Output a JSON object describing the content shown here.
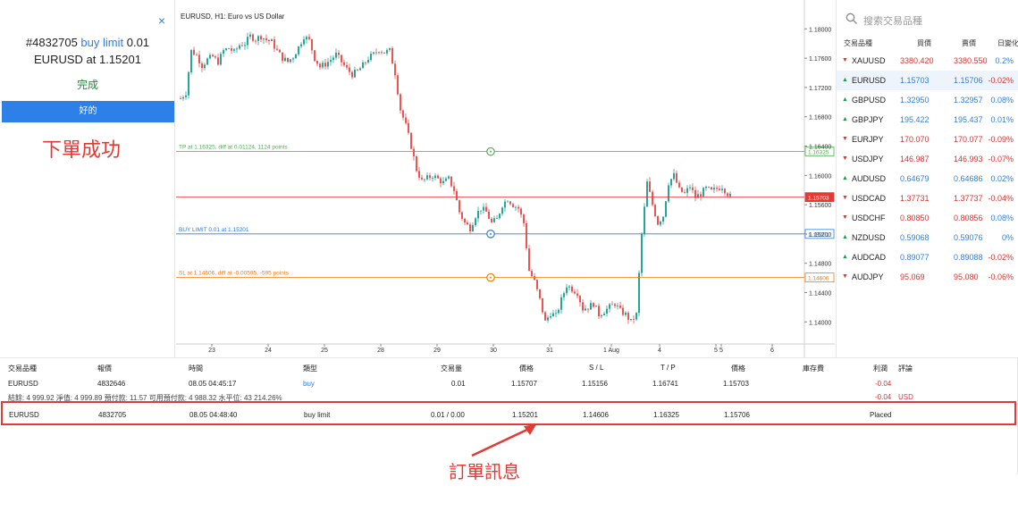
{
  "order_panel": {
    "close_icon": "×",
    "order_ticket": "#4832705",
    "order_type": "buy limit",
    "order_volume": "0.01",
    "order_line2": "EURUSD at 1.15201",
    "status": "完成",
    "ok_label": "好的"
  },
  "annotations": {
    "success": "下單成功",
    "order_info": "訂單訊息"
  },
  "chart": {
    "title": "EURUSD, H1: Euro vs US Dollar",
    "current_price": "1.15703",
    "lines": {
      "tp_label": "TP at 1.16325, diff at 0.01124, 1124 points",
      "tp_tag": "1.16325",
      "buy_label": "BUY LIMIT 0.01 at 1.15201",
      "buy_tag": "1.15201",
      "sl_label": "SL at 1.14606, diff at -0.00595, -595 points",
      "sl_tag": "1.14606"
    },
    "colors": {
      "up": "#26a69a",
      "down": "#ef5350",
      "tp": "#4caf50",
      "buy": "#2d7fe0",
      "sl": "#f57c00",
      "bid": "#e53935"
    }
  },
  "chart_data": {
    "type": "candlestick",
    "title": "EURUSD, H1: Euro vs US Dollar",
    "y_ticks": [
      "1.18000",
      "1.17600",
      "1.17200",
      "1.16800",
      "1.16400",
      "1.16000",
      "1.15600",
      "1.15200",
      "1.14800",
      "1.14400",
      "1.14000"
    ],
    "x_ticks": [
      "23",
      "24",
      "25",
      "28",
      "29",
      "30",
      "31",
      "1 Aug",
      "4",
      "5",
      "5",
      "6"
    ],
    "ylim": [
      1.1376,
      1.1815
    ],
    "levels": {
      "tp": 1.16325,
      "buy_limit": 1.15201,
      "sl": 1.14606,
      "bid": 1.15703
    },
    "close_path": [
      [
        0,
        1.1705
      ],
      [
        6,
        1.1713
      ],
      [
        12,
        1.177
      ],
      [
        18,
        1.1764
      ],
      [
        24,
        1.175
      ],
      [
        30,
        1.1758
      ],
      [
        36,
        1.1762
      ],
      [
        42,
        1.1755
      ],
      [
        48,
        1.177
      ],
      [
        54,
        1.1774
      ],
      [
        60,
        1.1768
      ],
      [
        66,
        1.1778
      ],
      [
        72,
        1.178
      ],
      [
        78,
        1.179
      ],
      [
        84,
        1.1786
      ],
      [
        90,
        1.179
      ],
      [
        96,
        1.1785
      ],
      [
        102,
        1.1782
      ],
      [
        108,
        1.177
      ],
      [
        114,
        1.176
      ],
      [
        120,
        1.1755
      ],
      [
        126,
        1.1762
      ],
      [
        132,
        1.1775
      ],
      [
        138,
        1.179
      ],
      [
        144,
        1.1784
      ],
      [
        150,
        1.176
      ],
      [
        156,
        1.1748
      ],
      [
        162,
        1.1752
      ],
      [
        168,
        1.1758
      ],
      [
        174,
        1.1765
      ],
      [
        180,
        1.1755
      ],
      [
        186,
        1.1745
      ],
      [
        192,
        1.1738
      ],
      [
        198,
        1.1742
      ],
      [
        204,
        1.175
      ],
      [
        210,
        1.176
      ],
      [
        216,
        1.1765
      ],
      [
        222,
        1.1772
      ],
      [
        228,
        1.1768
      ],
      [
        234,
        1.177
      ],
      [
        240,
        1.174
      ],
      [
        246,
        1.169
      ],
      [
        252,
        1.1668
      ],
      [
        258,
        1.164
      ],
      [
        264,
        1.1608
      ],
      [
        270,
        1.1592
      ],
      [
        276,
        1.1596
      ],
      [
        282,
        1.16
      ],
      [
        288,
        1.1595
      ],
      [
        294,
        1.159
      ],
      [
        300,
        1.1595
      ],
      [
        306,
        1.158
      ],
      [
        312,
        1.155
      ],
      [
        318,
        1.1535
      ],
      [
        324,
        1.1528
      ],
      [
        330,
        1.1545
      ],
      [
        336,
        1.1555
      ],
      [
        342,
        1.155
      ],
      [
        348,
        1.1535
      ],
      [
        354,
        1.154
      ],
      [
        360,
        1.156
      ],
      [
        366,
        1.1568
      ],
      [
        372,
        1.156
      ],
      [
        378,
        1.1555
      ],
      [
        384,
        1.1535
      ],
      [
        390,
        1.147
      ],
      [
        396,
        1.1455
      ],
      [
        402,
        1.143
      ],
      [
        408,
        1.14
      ],
      [
        414,
        1.1412
      ],
      [
        420,
        1.1408
      ],
      [
        426,
        1.143
      ],
      [
        432,
        1.145
      ],
      [
        438,
        1.1445
      ],
      [
        444,
        1.144
      ],
      [
        450,
        1.1418
      ],
      [
        456,
        1.142
      ],
      [
        462,
        1.1425
      ],
      [
        468,
        1.141
      ],
      [
        474,
        1.1415
      ],
      [
        480,
        1.142
      ],
      [
        486,
        1.1425
      ],
      [
        492,
        1.1415
      ],
      [
        498,
        1.141
      ],
      [
        504,
        1.14
      ],
      [
        510,
        1.141
      ],
      [
        516,
        1.152
      ],
      [
        522,
        1.159
      ],
      [
        528,
        1.156
      ],
      [
        534,
        1.1535
      ],
      [
        540,
        1.1545
      ],
      [
        546,
        1.159
      ],
      [
        552,
        1.16
      ],
      [
        558,
        1.158
      ],
      [
        564,
        1.1575
      ],
      [
        570,
        1.1585
      ],
      [
        576,
        1.157
      ],
      [
        582,
        1.1575
      ],
      [
        588,
        1.1582
      ],
      [
        594,
        1.1578
      ],
      [
        600,
        1.1582
      ],
      [
        606,
        1.1585
      ],
      [
        612,
        1.1575
      ],
      [
        616,
        1.157
      ]
    ]
  },
  "watchlist": {
    "search_placeholder": "搜索交易品種",
    "headers": [
      "交易品種",
      "買價",
      "賣價",
      "日變化"
    ],
    "rows": [
      {
        "symbol": "XAUUSD",
        "dir": "down",
        "bid": "3380.420",
        "ask": "3380.550",
        "change": "0.2%",
        "color": "red",
        "change_color": "blue"
      },
      {
        "symbol": "EURUSD",
        "dir": "up",
        "bid": "1.15703",
        "ask": "1.15706",
        "change": "-0.02%",
        "color": "blue",
        "change_color": "red",
        "selected": true
      },
      {
        "symbol": "GBPUSD",
        "dir": "up",
        "bid": "1.32950",
        "ask": "1.32957",
        "change": "0.08%",
        "color": "blue",
        "change_color": "blue"
      },
      {
        "symbol": "GBPJPY",
        "dir": "up",
        "bid": "195.422",
        "ask": "195.437",
        "change": "0.01%",
        "color": "blue",
        "change_color": "blue"
      },
      {
        "symbol": "EURJPY",
        "dir": "down",
        "bid": "170.070",
        "ask": "170.077",
        "change": "-0.09%",
        "color": "red",
        "change_color": "red"
      },
      {
        "symbol": "USDJPY",
        "dir": "down",
        "bid": "146.987",
        "ask": "146.993",
        "change": "-0.07%",
        "color": "red",
        "change_color": "red"
      },
      {
        "symbol": "AUDUSD",
        "dir": "up",
        "bid": "0.64679",
        "ask": "0.64686",
        "change": "0.02%",
        "color": "blue",
        "change_color": "blue"
      },
      {
        "symbol": "USDCAD",
        "dir": "down",
        "bid": "1.37731",
        "ask": "1.37737",
        "change": "-0.04%",
        "color": "red",
        "change_color": "red"
      },
      {
        "symbol": "USDCHF",
        "dir": "down",
        "bid": "0.80850",
        "ask": "0.80856",
        "change": "0.08%",
        "color": "red",
        "change_color": "blue"
      },
      {
        "symbol": "NZDUSD",
        "dir": "up",
        "bid": "0.59068",
        "ask": "0.59076",
        "change": "0%",
        "color": "blue",
        "change_color": "blue"
      },
      {
        "symbol": "AUDCAD",
        "dir": "up",
        "bid": "0.89077",
        "ask": "0.89088",
        "change": "-0.02%",
        "color": "blue",
        "change_color": "red"
      },
      {
        "symbol": "AUDJPY",
        "dir": "down",
        "bid": "95.069",
        "ask": "95.080",
        "change": "-0.06%",
        "color": "red",
        "change_color": "red"
      }
    ]
  },
  "table": {
    "headers": {
      "symbol": "交易品種",
      "ticket": "報價",
      "time": "時間",
      "type": "類型",
      "volume": "交易量",
      "price": "價格",
      "sl": "S / L",
      "tp": "T / P",
      "cur_price": "價格",
      "swap": "庫存費",
      "profit": "利潤",
      "comment": "評論"
    },
    "position": {
      "symbol": "EURUSD",
      "ticket": "4832646",
      "time": "08.05 04:45:17",
      "type": "buy",
      "volume": "0.01",
      "price": "1.15707",
      "sl": "1.15156",
      "tp": "1.16741",
      "cur_price": "1.15703",
      "profit": "-0.04"
    },
    "balance": {
      "text": "結餘: 4 999.92  淨值: 4 999.89  預付款: 11.57  可用預付款: 4 988.32  水平位: 43 214.26%",
      "profit": "-0.04",
      "currency": "USD"
    },
    "order": {
      "symbol": "EURUSD",
      "ticket": "4832705",
      "time": "08.05 04:48:40",
      "type": "buy limit",
      "volume": "0.01 / 0.00",
      "price": "1.15201",
      "sl": "1.14606",
      "tp": "1.16325",
      "cur_price": "1.15706",
      "status": "Placed"
    }
  }
}
